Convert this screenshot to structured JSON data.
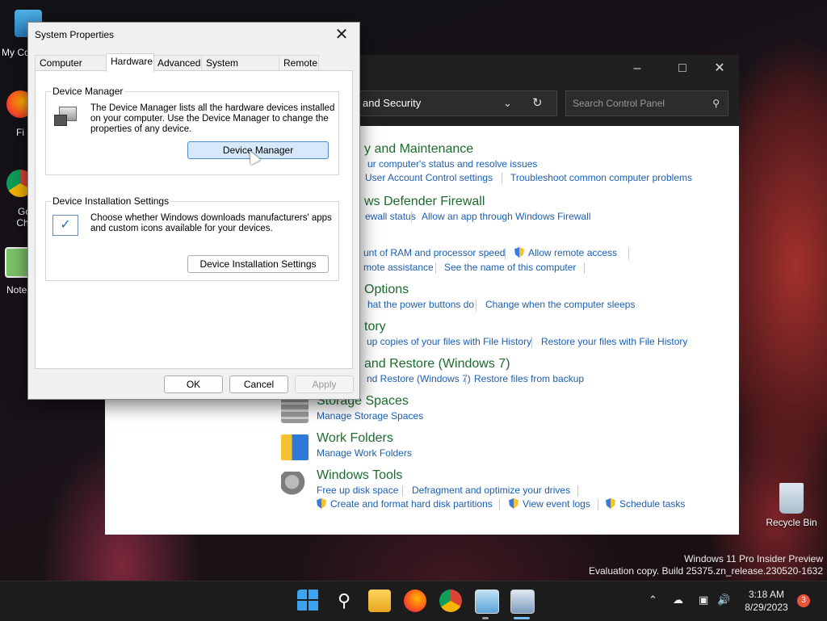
{
  "desktop": {
    "icons": [
      {
        "label": "My Co"
      },
      {
        "label": "Fi"
      },
      {
        "label": "Go Chr"
      },
      {
        "label": "Note"
      },
      {
        "label": "Recycle Bin"
      }
    ],
    "watermark_line1": "Windows 11 Pro Insider Preview",
    "watermark_line2": "Evaluation copy. Build 25375.zn_release.230520-1632"
  },
  "control_panel": {
    "path": "and Security",
    "search_placeholder": "Search Control Panel",
    "categories": [
      {
        "title": "y and Maintenance",
        "links": [
          "ur computer's status and resolve issues",
          "User Account Control settings",
          "Troubleshoot common computer problems"
        ]
      },
      {
        "title": "ws Defender Firewall",
        "links": [
          "ewall status",
          "Allow an app through Windows Firewall"
        ]
      },
      {
        "title": "",
        "links": [
          "unt of RAM and processor speed",
          "Allow remote access",
          "mote assistance",
          "See the name of this computer"
        ]
      },
      {
        "title": "Options",
        "links": [
          "hat the power buttons do",
          "Change when the computer sleeps"
        ]
      },
      {
        "title": "tory",
        "links": [
          "up copies of your files with File History",
          "Restore your files with File History"
        ]
      },
      {
        "title": "and Restore (Windows 7)",
        "links": [
          "nd Restore (Windows 7)",
          "Restore files from backup"
        ]
      },
      {
        "title": "Storage Spaces",
        "links": [
          "Manage Storage Spaces"
        ]
      },
      {
        "title": "Work Folders",
        "links": [
          "Manage Work Folders"
        ]
      },
      {
        "title": "Windows Tools",
        "links": [
          "Free up disk space",
          "Defragment and optimize your drives",
          "Create and format hard disk partitions",
          "View event logs",
          "Schedule tasks"
        ]
      }
    ]
  },
  "dialog": {
    "title": "System Properties",
    "tabs": [
      "Computer Name",
      "Hardware",
      "Advanced",
      "System Protection",
      "Remote"
    ],
    "active_tab": "Hardware",
    "device_manager": {
      "label": "Device Manager",
      "line1": "The Device Manager lists all the hardware devices installed",
      "line2": "on your computer. Use the Device Manager to change the",
      "line3": "properties of any device.",
      "button": "Device Manager"
    },
    "install_settings": {
      "label": "Device Installation Settings",
      "line1": "Choose whether Windows downloads manufacturers' apps",
      "line2": "and custom icons available for your devices.",
      "button": "Device Installation Settings"
    },
    "ok": "OK",
    "cancel": "Cancel",
    "apply": "Apply"
  },
  "taskbar": {
    "time": "3:18 AM",
    "date": "8/29/2023",
    "notification_count": "3"
  }
}
